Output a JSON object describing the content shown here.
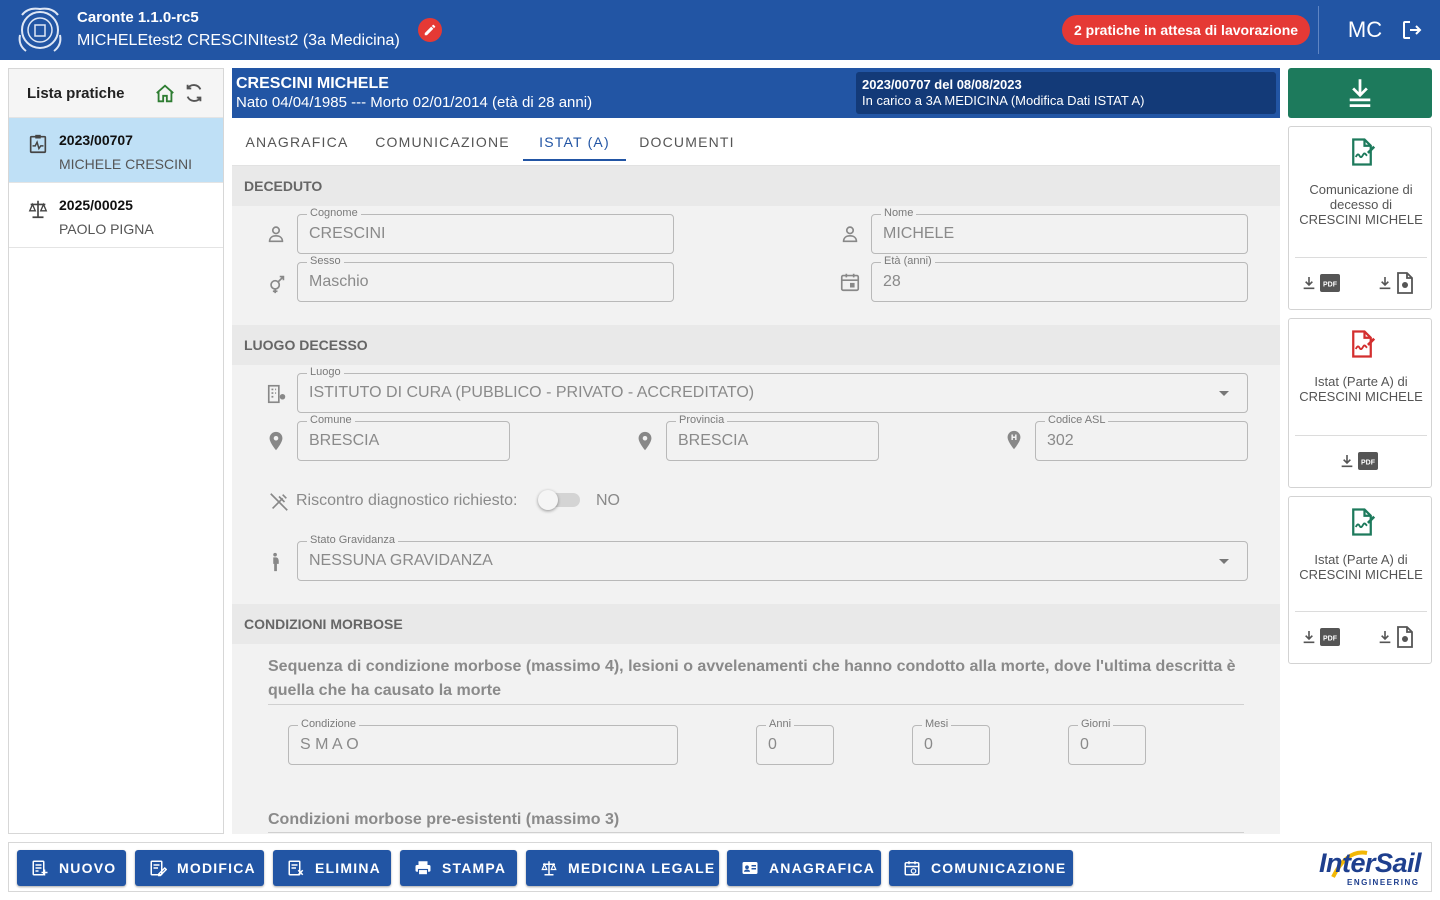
{
  "header": {
    "app_title": "Caronte 1.1.0-rc5",
    "user_line": "MICHELEtest2 CRESCINItest2 (3a Medicina)",
    "pending": "2 pratiche in attesa di lavorazione",
    "avatar": "MC"
  },
  "sidebar": {
    "title": "Lista pratiche",
    "items": [
      {
        "number": "2023/00707",
        "name": "MICHELE CRESCINI"
      },
      {
        "number": "2025/00025",
        "name": "PAOLO PIGNA"
      }
    ]
  },
  "patient": {
    "name": "CRESCINI MICHELE",
    "dates": "Nato 04/04/1985 --- Morto 02/01/2014 (età di 28 anni)",
    "case_ref": "2023/00707 del 08/08/2023",
    "case_status": "In carico a 3A MEDICINA (Modifica Dati ISTAT A)"
  },
  "tabs": [
    "ANAGRAFICA",
    "COMUNICAZIONE",
    "ISTAT (A)",
    "DOCUMENTI"
  ],
  "sections": {
    "deceduto": {
      "title": "DECEDUTO",
      "cognome": {
        "label": "Cognome",
        "value": "CRESCINI"
      },
      "nome": {
        "label": "Nome",
        "value": "MICHELE"
      },
      "sesso": {
        "label": "Sesso",
        "value": "Maschio"
      },
      "eta": {
        "label": "Età (anni)",
        "value": "28"
      }
    },
    "luogo": {
      "title": "LUOGO DECESSO",
      "luogo": {
        "label": "Luogo",
        "value": "ISTITUTO DI CURA (PUBBLICO - PRIVATO - ACCREDITATO)"
      },
      "comune": {
        "label": "Comune",
        "value": "BRESCIA"
      },
      "provincia": {
        "label": "Provincia",
        "value": "BRESCIA"
      },
      "asl": {
        "label": "Codice ASL",
        "value": "302"
      },
      "riscontro_label": "Riscontro diagnostico richiesto:",
      "riscontro_value": "NO",
      "gravidanza": {
        "label": "Stato Gravidanza",
        "value": "NESSUNA GRAVIDANZA"
      }
    },
    "condizioni": {
      "title": "CONDIZIONI MORBOSE",
      "sequence_title": "Sequenza di condizione morbose (massimo 4), lesioni o avvelenamenti che hanno condotto alla morte, dove l'ultima descritta è quella che ha causato la morte",
      "condizione": {
        "label": "Condizione",
        "value": "S M A O"
      },
      "anni": {
        "label": "Anni",
        "value": "0"
      },
      "mesi": {
        "label": "Mesi",
        "value": "0"
      },
      "giorni": {
        "label": "Giorni",
        "value": "0"
      },
      "preesistenti_title": "Condizioni morbose pre-esistenti (massimo 3)"
    }
  },
  "documents": [
    {
      "title": "Comunicazione di decesso di CRESCINI MICHELE",
      "color": "#1d7a5c",
      "pdf_tag": "PDF"
    },
    {
      "title": "Istat (Parte A) di CRESCINI MICHELE",
      "color": "#d32f2f",
      "pdf_tag": "PDF"
    },
    {
      "title": "Istat (Parte A) di CRESCINI MICHELE",
      "color": "#1d7a5c",
      "pdf_tag": "PDF"
    }
  ],
  "toolbar": {
    "buttons": [
      "NUOVO",
      "MODIFICA",
      "ELIMINA",
      "STAMPA",
      "MEDICINA LEGALE",
      "ANAGRAFICA",
      "COMUNICAZIONE"
    ]
  },
  "brand": {
    "name": "InterSail",
    "sub": "ENGINEERING"
  },
  "colors": {
    "primary": "#2255a4",
    "accent_green": "#1d7a5c",
    "danger": "#e53935",
    "selected": "#bfe0f6"
  }
}
